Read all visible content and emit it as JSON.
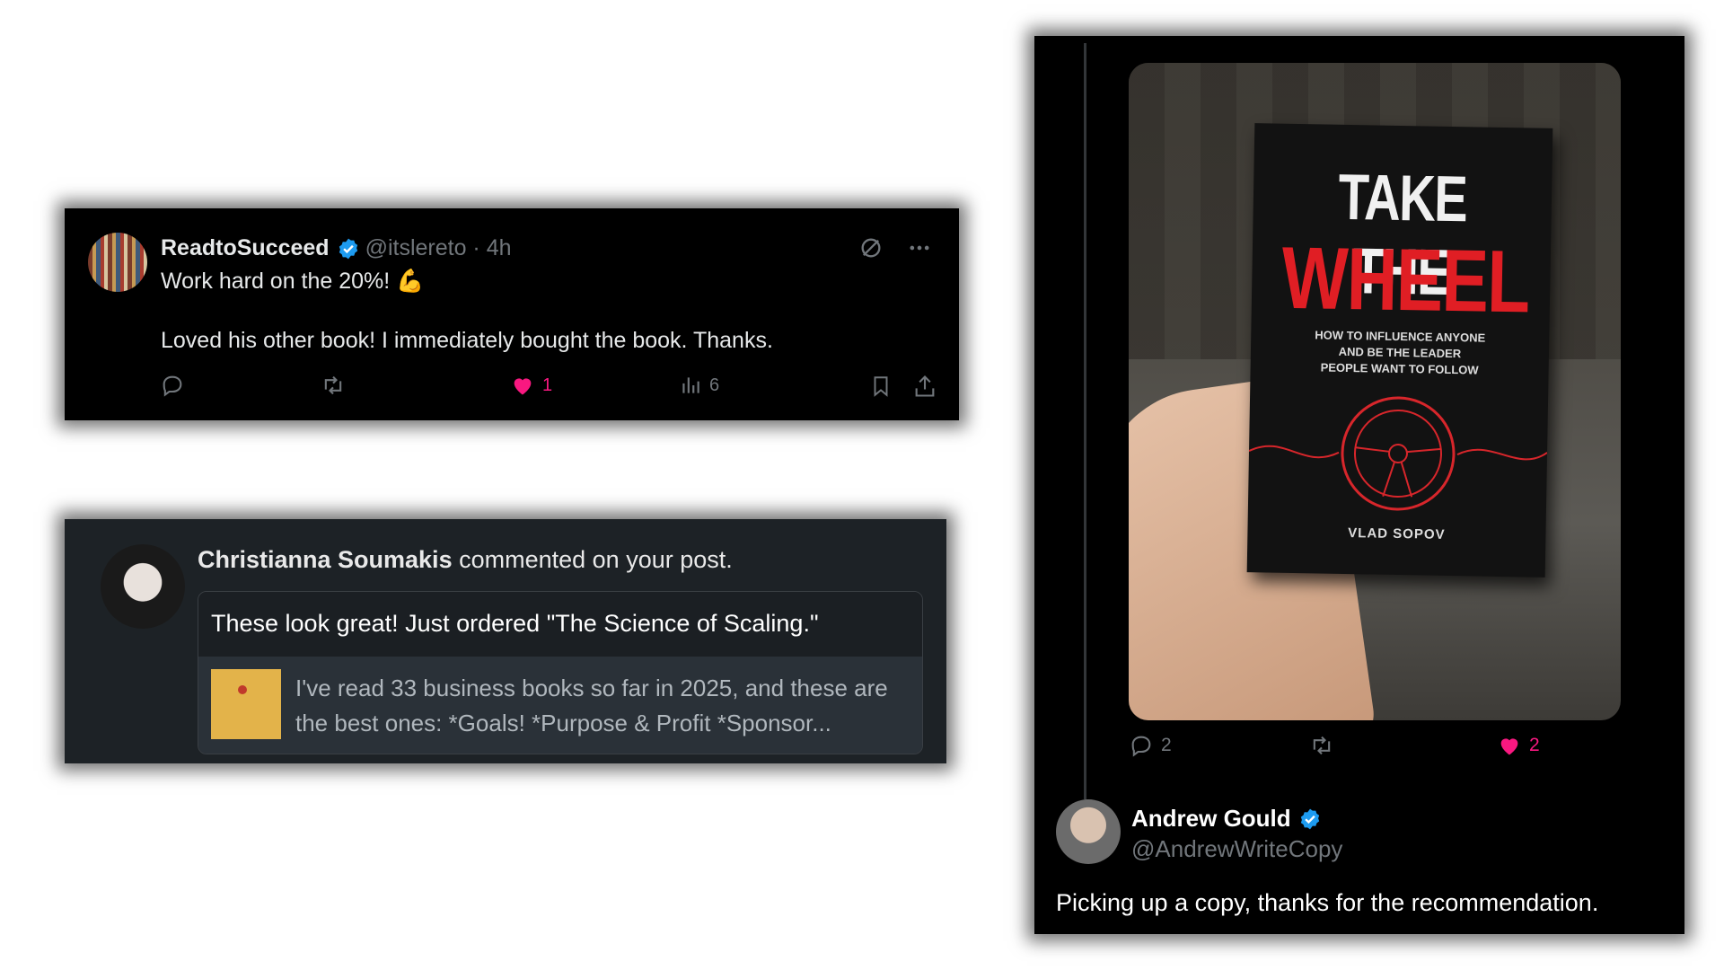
{
  "tweet1": {
    "name": "ReadtoSucceed",
    "handle_time": "@itslereto · 4h",
    "line1": "Work hard on the 20%! 💪",
    "line2": "Loved his other book! I immediately bought the book. Thanks.",
    "likes": "1",
    "views": "6",
    "icons": [
      "reply-icon",
      "retweet-icon",
      "heart-icon",
      "views-icon",
      "bookmark-icon",
      "share-icon",
      "grok-icon",
      "more-icon"
    ],
    "like_color": "#f91880",
    "verified_color": "#1d9bf0"
  },
  "notification": {
    "commenter": "Christianna Soumakis",
    "action_text": " commented on your post.",
    "comment": "These look great! Just ordered \"The Science of Scaling.\"",
    "post_excerpt": "I've read 33 business books so far in 2025, and these are the best ones: *Goals! *Purpose & Profit *Sponsor..."
  },
  "reply": {
    "book_title_line1": "TAKE THE",
    "book_title_line2": "WHEEL",
    "book_subtitle": [
      "HOW TO INFLUENCE ANYONE",
      "AND BE THE LEADER",
      "PEOPLE WANT TO FOLLOW"
    ],
    "book_author": "VLAD SOPOV",
    "replies": "2",
    "likes": "2",
    "name": "Andrew Gould",
    "handle": "@AndrewWriteCopy",
    "text": "Picking up a copy, thanks for the recommendation."
  }
}
